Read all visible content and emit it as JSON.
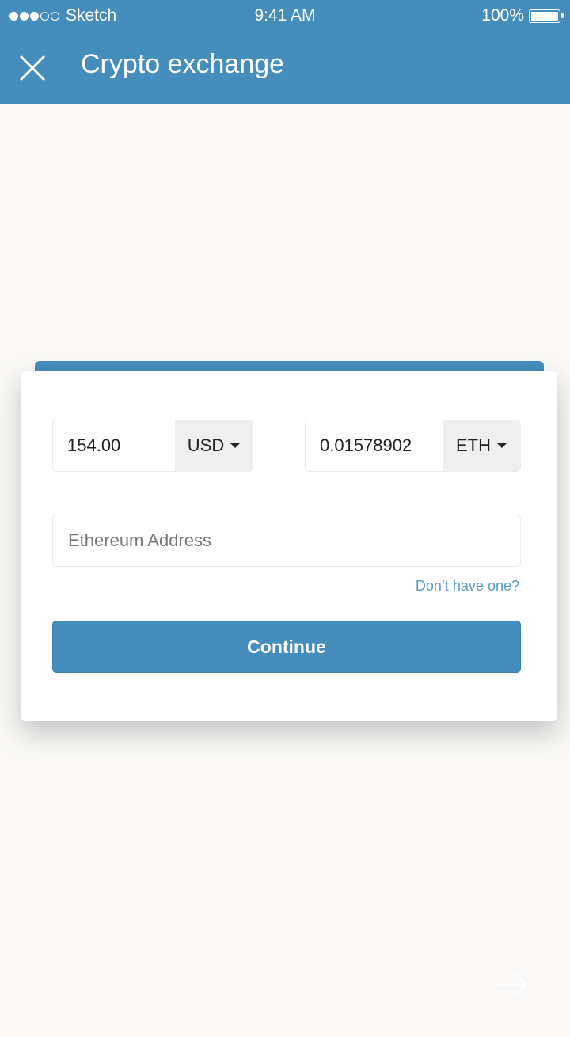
{
  "status_bar": {
    "carrier": "Sketch",
    "time": "9:41 AM",
    "battery_percent": "100%",
    "signal_filled": 3,
    "signal_total": 5
  },
  "header": {
    "title": "Crypto exchange",
    "close_icon": "close-icon",
    "background_color": "#448dbc"
  },
  "exchange": {
    "from_amount": "154.00",
    "from_currency": "USD",
    "to_amount": "0.01578902",
    "to_currency": "ETH"
  },
  "address": {
    "placeholder": "Ethereum Address",
    "value": ""
  },
  "help_link": "Don’t have one?",
  "continue_label": "Continue",
  "footer": {
    "next_icon": "arrow-right-icon"
  }
}
